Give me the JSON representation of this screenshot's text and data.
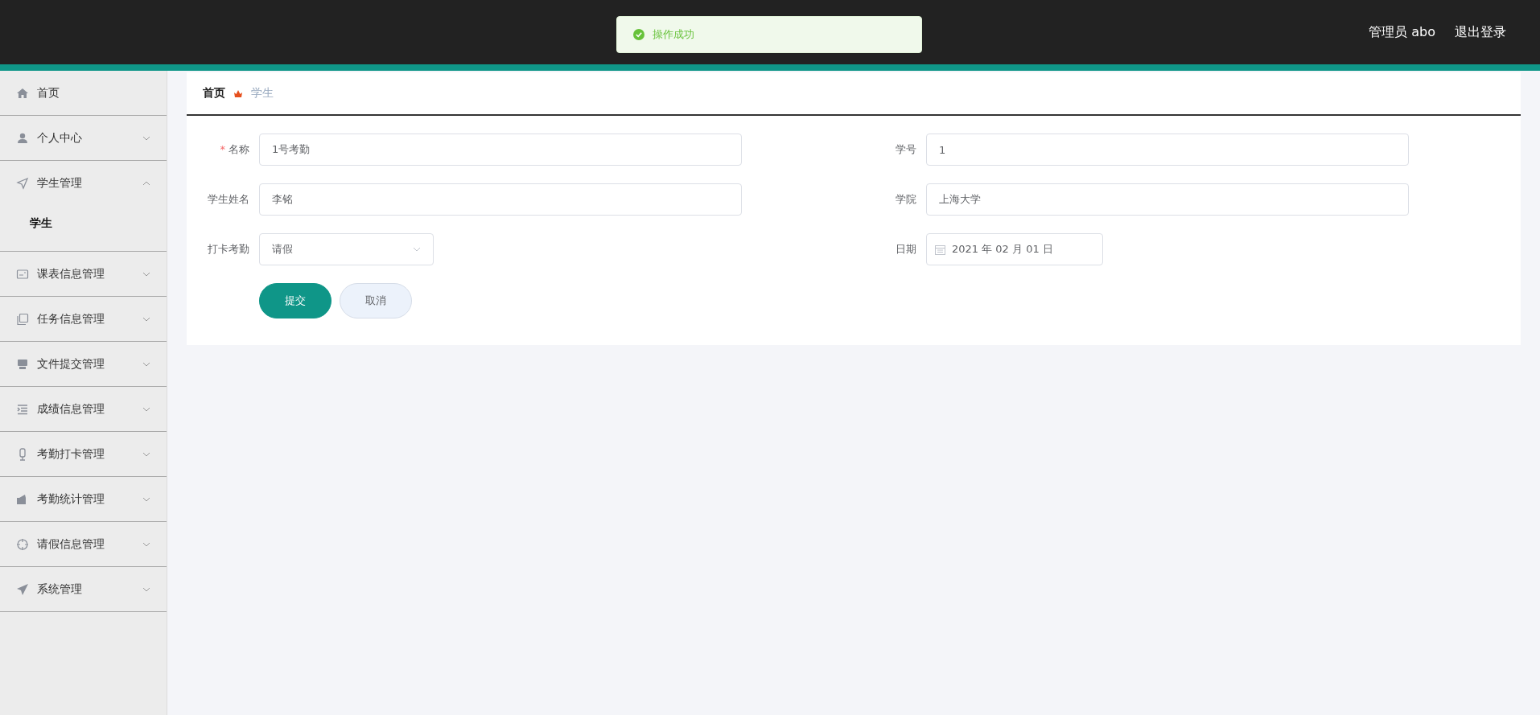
{
  "header": {
    "user": "管理员 abo",
    "logout": "退出登录"
  },
  "toast": {
    "message": "操作成功"
  },
  "sidebar": {
    "items": [
      {
        "label": "首页",
        "kind": "link"
      },
      {
        "label": "个人中心",
        "kind": "menu",
        "expanded": false
      },
      {
        "label": "学生管理",
        "kind": "menu",
        "expanded": true,
        "children": [
          {
            "label": "学生",
            "selected": true
          }
        ]
      },
      {
        "label": "课表信息管理",
        "kind": "menu",
        "expanded": false
      },
      {
        "label": "任务信息管理",
        "kind": "menu",
        "expanded": false
      },
      {
        "label": "文件提交管理",
        "kind": "menu",
        "expanded": false
      },
      {
        "label": "成绩信息管理",
        "kind": "menu",
        "expanded": false
      },
      {
        "label": "考勤打卡管理",
        "kind": "menu",
        "expanded": false
      },
      {
        "label": "考勤统计管理",
        "kind": "menu",
        "expanded": false
      },
      {
        "label": "请假信息管理",
        "kind": "menu",
        "expanded": false
      },
      {
        "label": "系统管理",
        "kind": "menu",
        "expanded": false
      }
    ]
  },
  "breadcrumb": [
    "首页",
    "学生"
  ],
  "form": {
    "fields": [
      {
        "label": "名称",
        "required_mark": "*",
        "kind": "text",
        "value": "1号考勤"
      },
      {
        "label": "学号",
        "kind": "text",
        "value": "1"
      },
      {
        "label": "学生姓名",
        "kind": "text",
        "value": "李铭"
      },
      {
        "label": "学院",
        "kind": "text",
        "value": "上海大学"
      },
      {
        "label": "打卡考勤",
        "kind": "select",
        "value": "请假"
      },
      {
        "label": "日期",
        "kind": "date",
        "value": "2021 年 02 月 01 日"
      }
    ],
    "buttons": [
      {
        "label": "提交",
        "kind": "primary"
      },
      {
        "label": "取消",
        "kind": "secondary"
      }
    ]
  }
}
